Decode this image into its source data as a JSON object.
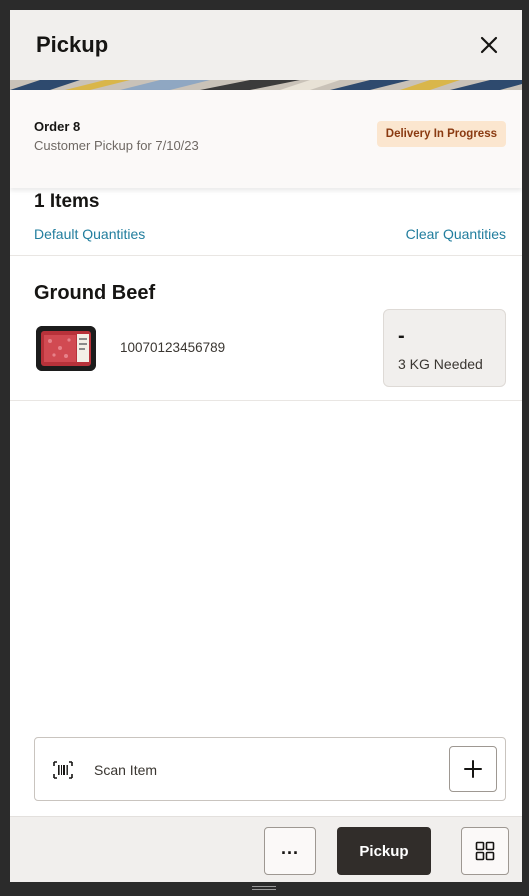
{
  "header": {
    "title": "Pickup",
    "close_icon": "close-icon"
  },
  "order": {
    "title": "Order 8",
    "subtitle": "Customer Pickup for 7/10/23",
    "status": "Delivery In Progress",
    "status_bg": "#fbe6cf",
    "status_fg": "#8a3a11"
  },
  "items": {
    "count_label": "1 Items",
    "default_link": "Default Quantities",
    "clear_link": "Clear Quantities"
  },
  "product": {
    "name": "Ground Beef",
    "image": "ground-beef-package-thumbnail",
    "code": "10070123456789",
    "qty_value": "-",
    "qty_needed": "3 KG Needed"
  },
  "scan": {
    "icon": "barcode-icon",
    "label": "Scan Item",
    "add_icon": "plus-icon"
  },
  "footer": {
    "more_label": "...",
    "primary_label": "Pickup",
    "grid_icon": "grid-icon"
  },
  "colors": {
    "link": "#227e9e",
    "primary_button": "#312d2a",
    "header_bg": "#f1efed"
  }
}
